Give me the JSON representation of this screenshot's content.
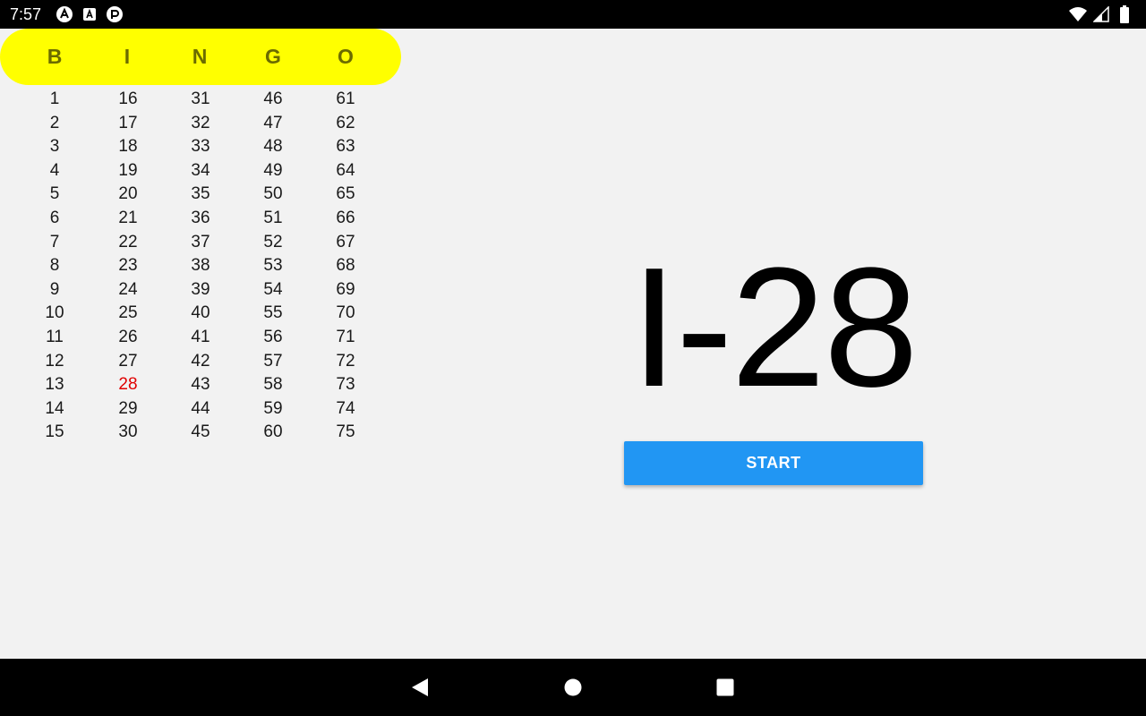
{
  "status_bar": {
    "time": "7:57",
    "left_icons": [
      "android-studio-icon",
      "app-a-icon",
      "app-p-icon"
    ],
    "right_icons": [
      "wifi-icon",
      "signal-icon",
      "battery-icon"
    ]
  },
  "header": {
    "letters": [
      "B",
      "I",
      "N",
      "G",
      "O"
    ]
  },
  "board": {
    "columns": [
      [
        "1",
        "2",
        "3",
        "4",
        "5",
        "6",
        "7",
        "8",
        "9",
        "10",
        "11",
        "12",
        "13",
        "14",
        "15"
      ],
      [
        "16",
        "17",
        "18",
        "19",
        "20",
        "21",
        "22",
        "23",
        "24",
        "25",
        "26",
        "27",
        "28",
        "29",
        "30"
      ],
      [
        "31",
        "32",
        "33",
        "34",
        "35",
        "36",
        "37",
        "38",
        "39",
        "40",
        "41",
        "42",
        "43",
        "44",
        "45"
      ],
      [
        "46",
        "47",
        "48",
        "49",
        "50",
        "51",
        "52",
        "53",
        "54",
        "55",
        "56",
        "57",
        "58",
        "59",
        "60"
      ],
      [
        "61",
        "62",
        "63",
        "64",
        "65",
        "66",
        "67",
        "68",
        "69",
        "70",
        "71",
        "72",
        "73",
        "74",
        "75"
      ]
    ],
    "called": [
      "28"
    ]
  },
  "current_call": "I-28",
  "start_button": {
    "label": "START"
  },
  "colors": {
    "header_bg": "#ffff00",
    "header_text": "#6b6b00",
    "called_number": "#e00000",
    "button_bg": "#2196f3"
  },
  "nav_bar": {
    "buttons": [
      "back-icon",
      "home-icon",
      "recents-icon"
    ]
  }
}
